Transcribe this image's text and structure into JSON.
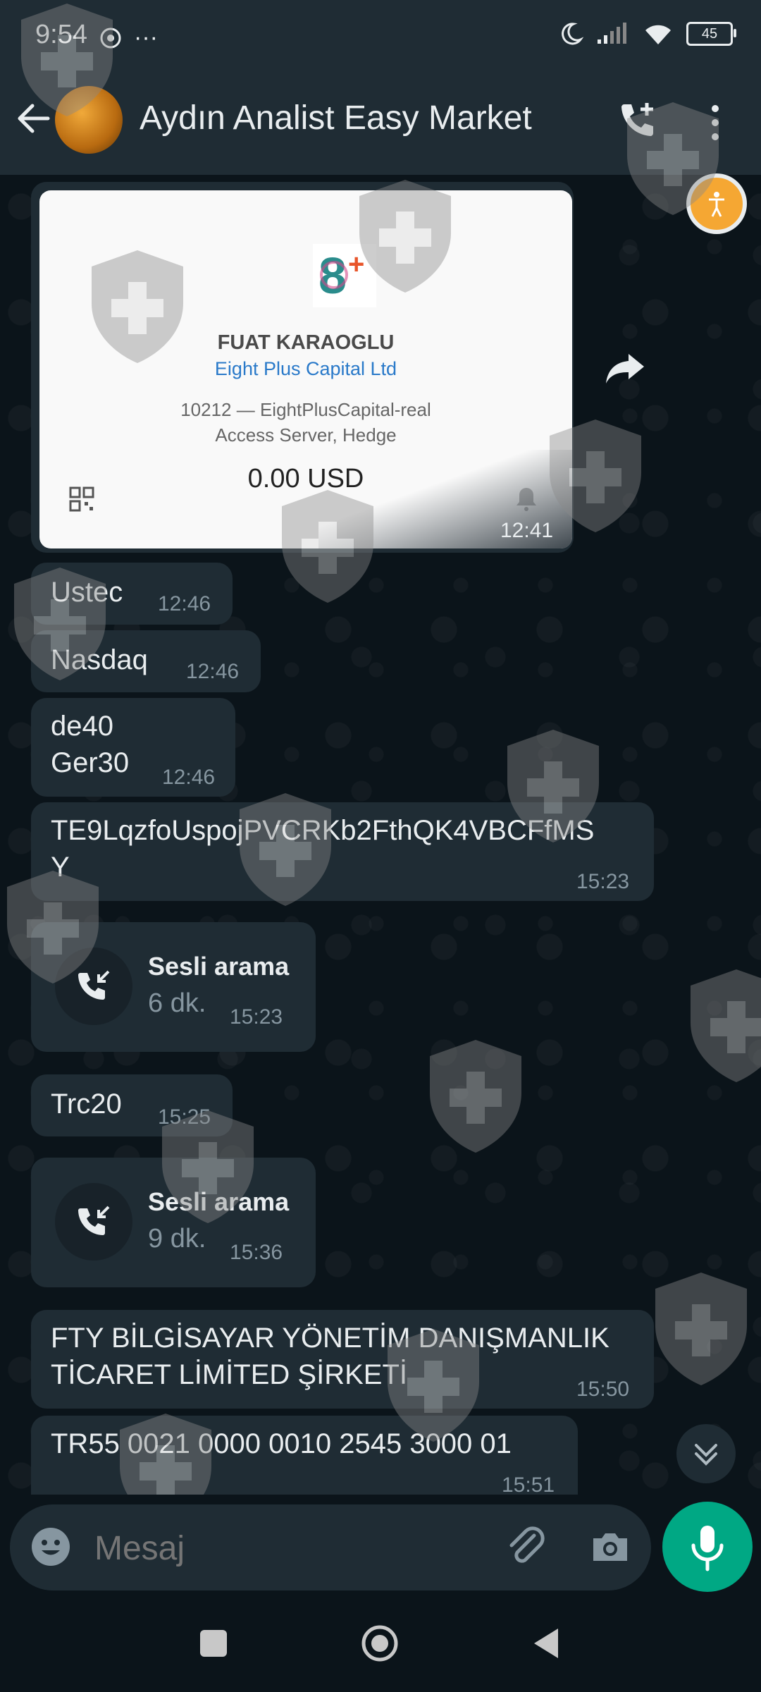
{
  "status_bar": {
    "time": "9:54",
    "dots": "···",
    "battery": "45"
  },
  "header": {
    "title": "Aydın Analist Easy Market"
  },
  "card": {
    "name": "FUAT KARAOGLU",
    "company": "Eight Plus Capital Ltd",
    "account": "10212 — EightPlusCapital-real",
    "server": "Access Server, Hedge",
    "balance": "0.00 USD",
    "time": "12:41",
    "logo_text": "8+"
  },
  "messages": [
    {
      "text": "Ustec",
      "time": "12:46"
    },
    {
      "text": "Nasdaq",
      "time": "12:46"
    },
    {
      "line1": "de40",
      "line2": "Ger30",
      "time": "12:46"
    },
    {
      "line1": "TE9LqzfoUspojPVCRKb2FthQK4VBCFfMS",
      "line2": "Y",
      "time": "15:23"
    },
    {
      "call_title": "Sesli arama",
      "duration": "6 dk.",
      "time": "15:23"
    },
    {
      "text": "Trc20",
      "time": "15:25"
    },
    {
      "call_title": "Sesli arama",
      "duration": "9 dk.",
      "time": "15:36"
    },
    {
      "line1": "FTY BİLGİSAYAR YÖNETİM DANIŞMANLIK",
      "line2": "TİCARET LİMİTED ŞİRKETİ",
      "time": "15:50"
    },
    {
      "text": "TR55 0021 0000 0010 2545 3000 01",
      "time": "15:51"
    }
  ],
  "input": {
    "placeholder": "Mesaj"
  },
  "colors": {
    "accent": "#00a884",
    "bubble": "#1f2c34",
    "background": "#0b141a",
    "link": "#2979c9"
  }
}
